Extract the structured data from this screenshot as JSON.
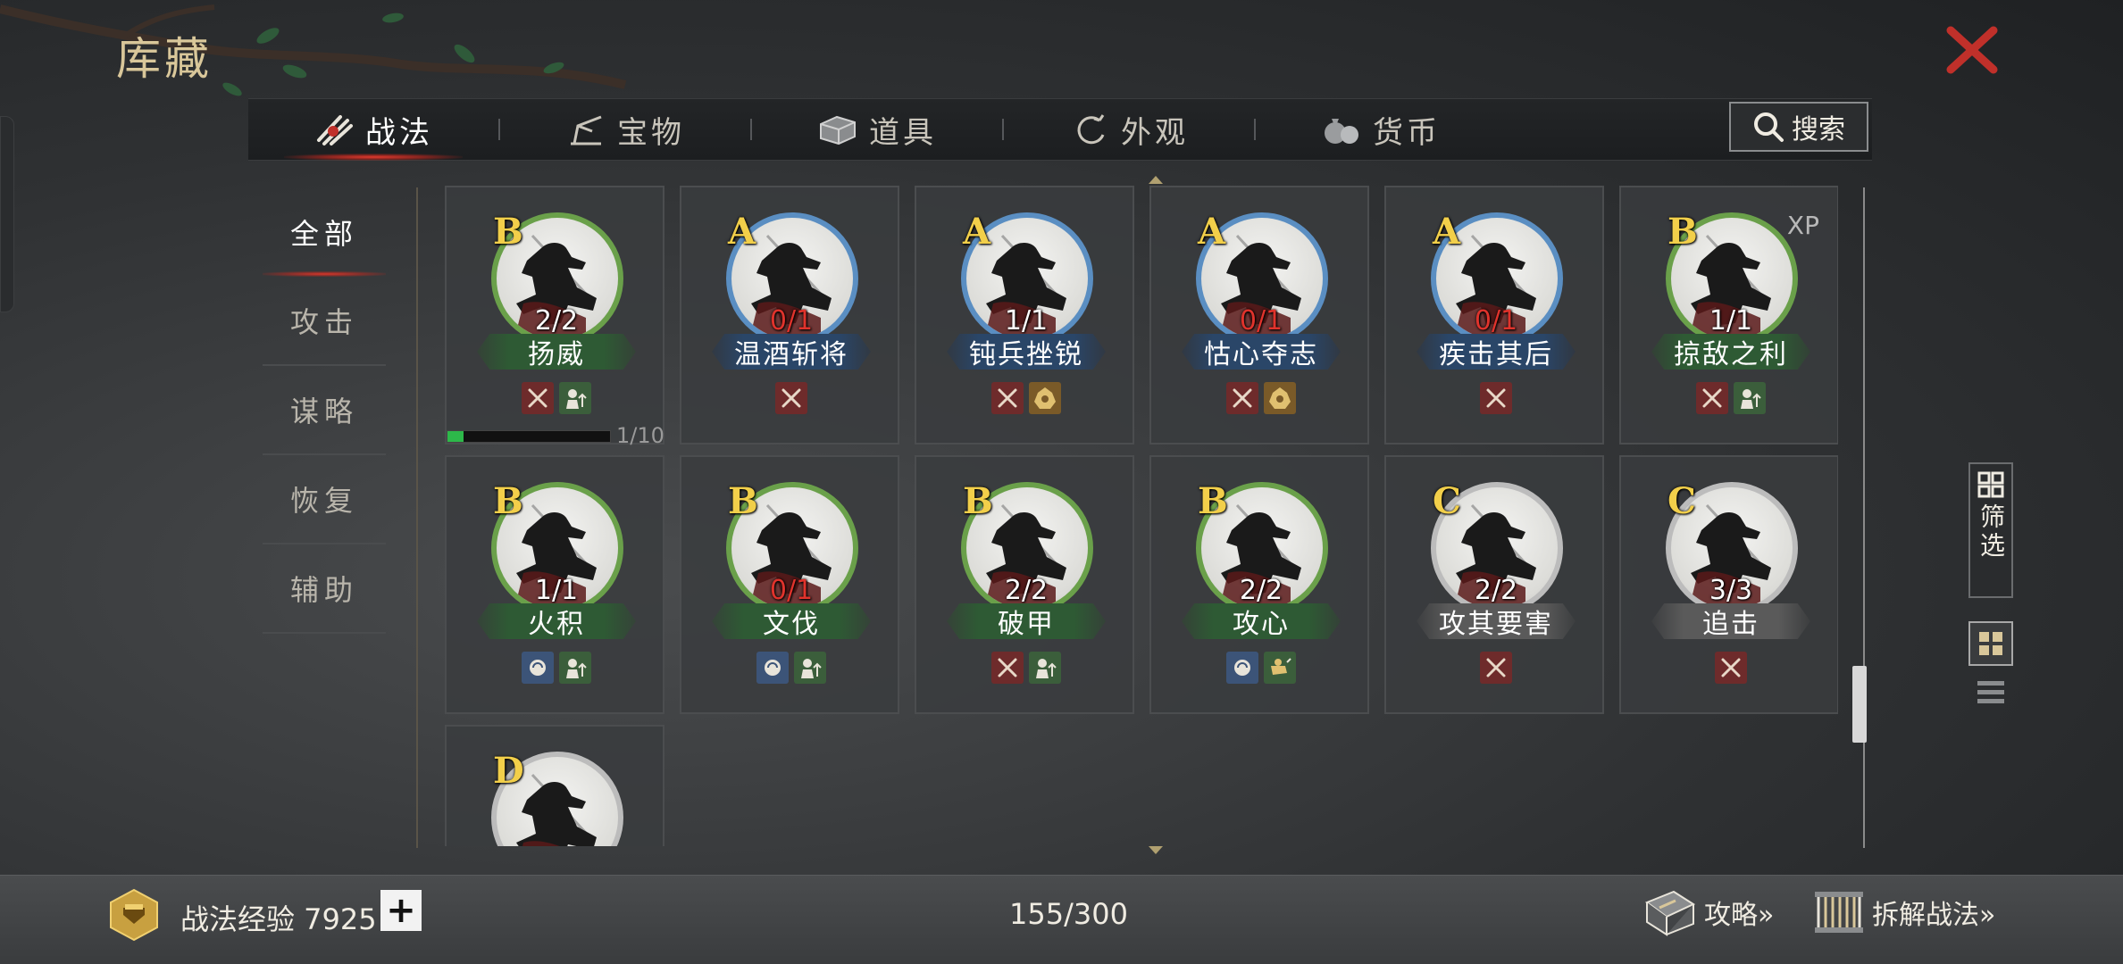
{
  "header": {
    "title": "库藏"
  },
  "tabs": [
    {
      "label": "战法",
      "icon": "scroll-bundle-icon",
      "active": true
    },
    {
      "label": "宝物",
      "icon": "treasure-icon",
      "active": false
    },
    {
      "label": "道具",
      "icon": "chest-icon",
      "active": false
    },
    {
      "label": "外观",
      "icon": "swirl-icon",
      "active": false
    },
    {
      "label": "货币",
      "icon": "money-bag-icon",
      "active": false
    }
  ],
  "search": {
    "label": "搜索"
  },
  "categories": [
    {
      "label": "全部",
      "active": true
    },
    {
      "label": "攻击",
      "active": false
    },
    {
      "label": "谋略",
      "active": false
    },
    {
      "label": "恢复",
      "active": false
    },
    {
      "label": "辅助",
      "active": false
    }
  ],
  "skills": [
    {
      "grade": "B",
      "name": "扬威",
      "count": "2/2",
      "count_color": "white",
      "ring": "green",
      "name_color": "green",
      "tags": [
        "attack",
        "buff"
      ],
      "progress": {
        "value": 0.1,
        "label": "1/10"
      }
    },
    {
      "grade": "A",
      "name": "温酒斩将",
      "count": "0/1",
      "count_color": "red",
      "ring": "blue",
      "name_color": "blue",
      "tags": [
        "attack"
      ]
    },
    {
      "grade": "A",
      "name": "钝兵挫锐",
      "count": "1/1",
      "count_color": "white",
      "ring": "blue",
      "name_color": "blue",
      "tags": [
        "attack",
        "control"
      ]
    },
    {
      "grade": "A",
      "name": "怙心夺志",
      "count": "0/1",
      "count_color": "red",
      "ring": "blue",
      "name_color": "blue",
      "tags": [
        "attack",
        "control"
      ]
    },
    {
      "grade": "A",
      "name": "疾击其后",
      "count": "0/1",
      "count_color": "red",
      "ring": "blue",
      "name_color": "blue",
      "tags": [
        "attack"
      ]
    },
    {
      "grade": "B",
      "name": "掠敌之利",
      "count": "1/1",
      "count_color": "white",
      "ring": "green",
      "name_color": "green",
      "tags": [
        "attack",
        "buff"
      ],
      "xp": "XP"
    },
    {
      "grade": "B",
      "name": "火积",
      "count": "1/1",
      "count_color": "white",
      "ring": "green",
      "name_color": "green",
      "tags": [
        "intel",
        "buff"
      ]
    },
    {
      "grade": "B",
      "name": "文伐",
      "count": "0/1",
      "count_color": "red",
      "ring": "green",
      "name_color": "green",
      "tags": [
        "intel",
        "buff"
      ]
    },
    {
      "grade": "B",
      "name": "破甲",
      "count": "2/2",
      "count_color": "white",
      "ring": "green",
      "name_color": "green",
      "tags": [
        "attack",
        "buff"
      ]
    },
    {
      "grade": "B",
      "name": "攻心",
      "count": "2/2",
      "count_color": "white",
      "ring": "green",
      "name_color": "green",
      "tags": [
        "intel",
        "heal"
      ]
    },
    {
      "grade": "C",
      "name": "攻其要害",
      "count": "2/2",
      "count_color": "white",
      "ring": "gray",
      "name_color": "gray",
      "tags": [
        "attack"
      ]
    },
    {
      "grade": "C",
      "name": "追击",
      "count": "3/3",
      "count_color": "white",
      "ring": "gray",
      "name_color": "gray",
      "tags": [
        "attack"
      ]
    },
    {
      "grade": "D",
      "name": "",
      "count": "",
      "count_color": "white",
      "ring": "gray",
      "name_color": "gray",
      "tags": []
    }
  ],
  "side": {
    "filter_label": "筛选"
  },
  "footer": {
    "exp_label": "战法经验 7925",
    "plus": "+",
    "capacity": "155/300",
    "guide_label": "攻略»",
    "decompose_label": "拆解战法»"
  }
}
